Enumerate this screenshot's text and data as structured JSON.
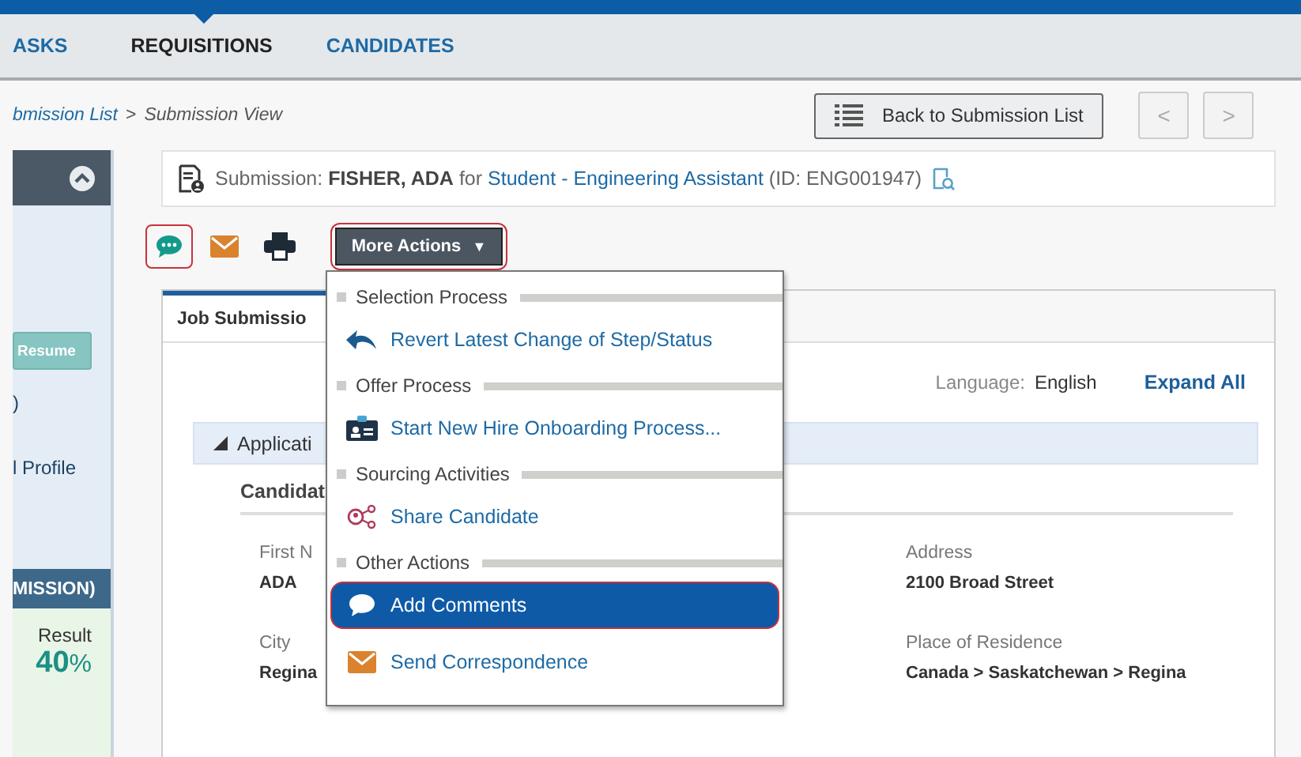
{
  "nav": {
    "tabs": [
      {
        "label": "ASKS",
        "selected": false
      },
      {
        "label": "REQUISITIONS",
        "selected": true
      },
      {
        "label": "CANDIDATES",
        "selected": false
      }
    ]
  },
  "breadcrumb": {
    "parent": "bmission List",
    "separator": ">",
    "current": "Submission View"
  },
  "back_button": "Back to Submission List",
  "pager": [
    {
      "label": "<",
      "disabled": true
    },
    {
      "label": ">",
      "disabled": true
    }
  ],
  "sidebar": {
    "resume_button": "Resume",
    "paren": ")",
    "profile_link": "l Profile",
    "band": "MISSION)",
    "result_label": "Result",
    "result_value": "**40**%"
  },
  "submission": {
    "label": "Submission:",
    "candidate": "FISHER, ADA",
    "for": "for",
    "requisition": "Student - Engineering Assistant",
    "id": "(ID: ENG001947)"
  },
  "toolbar": [
    {
      "kind": "comment",
      "highlighted": true
    },
    {
      "kind": "mail",
      "highlighted": false
    },
    {
      "kind": "print",
      "highlighted": false
    }
  ],
  "more_actions": {
    "label": "More Actions",
    "caret": "▼",
    "highlighted": true,
    "expanded": true
  },
  "menu": [
    {
      "group": "Selection Process",
      "items": [
        {
          "kind": "undo",
          "label": "Revert Latest Change of Step/Status",
          "selected": false,
          "highlighted": false
        }
      ]
    },
    {
      "group": "Offer Process",
      "items": [
        {
          "kind": "badge",
          "label": "Start New Hire Onboarding Process...",
          "selected": false,
          "highlighted": false
        }
      ]
    },
    {
      "group": "Sourcing Activities",
      "items": [
        {
          "kind": "share",
          "label": "Share Candidate",
          "selected": false,
          "highlighted": false
        }
      ]
    },
    {
      "group": "Other Actions",
      "items": [
        {
          "kind": "comment",
          "label": "Add Comments",
          "selected": true,
          "highlighted": true
        },
        {
          "kind": "mail",
          "label": "Send Correspondence",
          "selected": false,
          "highlighted": false
        }
      ]
    }
  ],
  "panel": {
    "tab": "Job Submissio",
    "language_label": "Language:",
    "language": "English",
    "expand_all": "Expand All",
    "section": "Applicati",
    "subsection": "Candidat",
    "fields_left": [
      {
        "label": "First N",
        "value": "ADA"
      },
      {
        "label": "City",
        "value": "Regina"
      }
    ],
    "fields_right": [
      {
        "label": "Address",
        "value": "2100 Broad Street"
      },
      {
        "label": "Place of Residence",
        "value": "Canada > Saskatchewan > Regina"
      }
    ]
  }
}
